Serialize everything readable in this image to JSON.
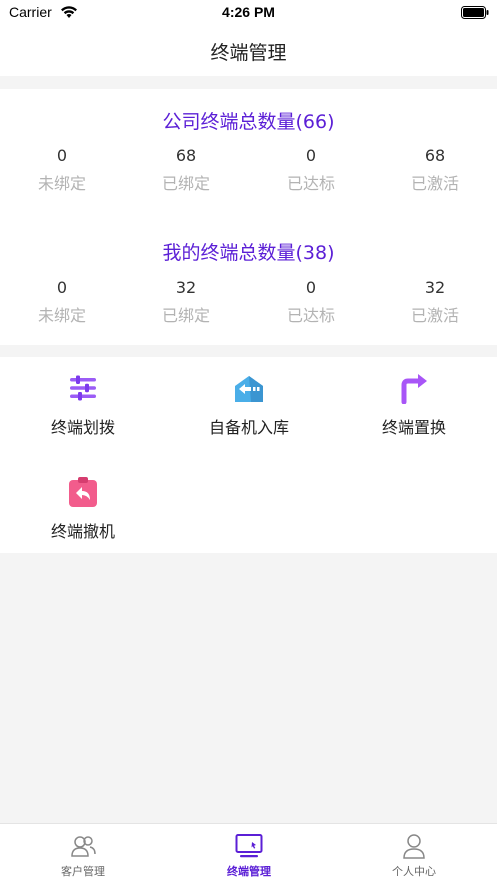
{
  "status_bar": {
    "carrier": "Carrier",
    "time": "4:26 PM"
  },
  "nav": {
    "title": "终端管理"
  },
  "company_stats": {
    "title": "公司终端总数量(66)",
    "items": [
      {
        "value": "0",
        "label": "未绑定"
      },
      {
        "value": "68",
        "label": "已绑定"
      },
      {
        "value": "0",
        "label": "已达标"
      },
      {
        "value": "68",
        "label": "已激活"
      }
    ]
  },
  "my_stats": {
    "title": "我的终端总数量(38)",
    "items": [
      {
        "value": "0",
        "label": "未绑定"
      },
      {
        "value": "32",
        "label": "已绑定"
      },
      {
        "value": "0",
        "label": "已达标"
      },
      {
        "value": "32",
        "label": "已激活"
      }
    ]
  },
  "actions": [
    {
      "label": "终端划拨",
      "icon": "sliders-icon",
      "color": "#9b5cf6"
    },
    {
      "label": "自备机入库",
      "icon": "warehouse-in-icon",
      "color": "#4aaee8"
    },
    {
      "label": "终端置换",
      "icon": "swap-arrow-icon",
      "color": "#a855f7"
    },
    {
      "label": "终端撤机",
      "icon": "clipboard-return-icon",
      "color": "#f25c8c"
    }
  ],
  "tabs": [
    {
      "label": "客户管理",
      "icon": "customers-icon",
      "active": false
    },
    {
      "label": "终端管理",
      "icon": "terminal-icon",
      "active": true
    },
    {
      "label": "个人中心",
      "icon": "user-icon",
      "active": false
    }
  ],
  "colors": {
    "accent": "#5b1fd6",
    "muted_label": "#b3b3b3",
    "background": "#f4f4f4"
  }
}
